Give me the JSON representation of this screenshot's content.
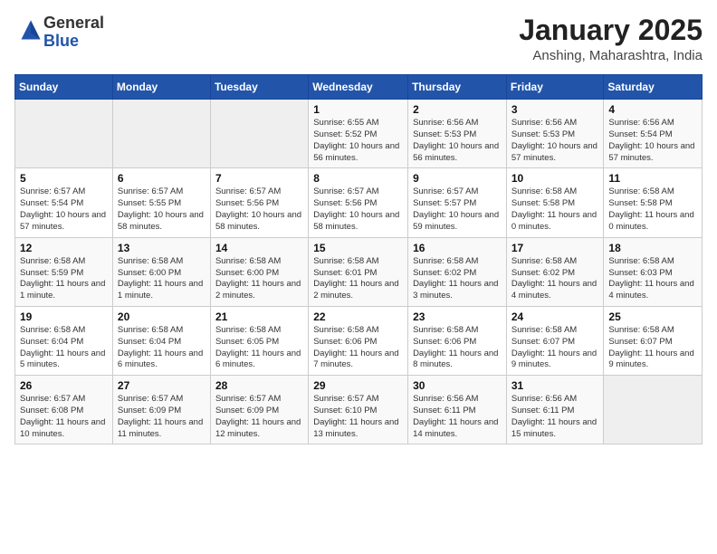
{
  "logo": {
    "general": "General",
    "blue": "Blue"
  },
  "header": {
    "title": "January 2025",
    "subtitle": "Anshing, Maharashtra, India"
  },
  "days_of_week": [
    "Sunday",
    "Monday",
    "Tuesday",
    "Wednesday",
    "Thursday",
    "Friday",
    "Saturday"
  ],
  "weeks": [
    [
      {
        "day": null
      },
      {
        "day": null
      },
      {
        "day": null
      },
      {
        "day": 1,
        "sunrise": "Sunrise: 6:55 AM",
        "sunset": "Sunset: 5:52 PM",
        "daylight": "Daylight: 10 hours and 56 minutes."
      },
      {
        "day": 2,
        "sunrise": "Sunrise: 6:56 AM",
        "sunset": "Sunset: 5:53 PM",
        "daylight": "Daylight: 10 hours and 56 minutes."
      },
      {
        "day": 3,
        "sunrise": "Sunrise: 6:56 AM",
        "sunset": "Sunset: 5:53 PM",
        "daylight": "Daylight: 10 hours and 57 minutes."
      },
      {
        "day": 4,
        "sunrise": "Sunrise: 6:56 AM",
        "sunset": "Sunset: 5:54 PM",
        "daylight": "Daylight: 10 hours and 57 minutes."
      }
    ],
    [
      {
        "day": 5,
        "sunrise": "Sunrise: 6:57 AM",
        "sunset": "Sunset: 5:54 PM",
        "daylight": "Daylight: 10 hours and 57 minutes."
      },
      {
        "day": 6,
        "sunrise": "Sunrise: 6:57 AM",
        "sunset": "Sunset: 5:55 PM",
        "daylight": "Daylight: 10 hours and 58 minutes."
      },
      {
        "day": 7,
        "sunrise": "Sunrise: 6:57 AM",
        "sunset": "Sunset: 5:56 PM",
        "daylight": "Daylight: 10 hours and 58 minutes."
      },
      {
        "day": 8,
        "sunrise": "Sunrise: 6:57 AM",
        "sunset": "Sunset: 5:56 PM",
        "daylight": "Daylight: 10 hours and 58 minutes."
      },
      {
        "day": 9,
        "sunrise": "Sunrise: 6:57 AM",
        "sunset": "Sunset: 5:57 PM",
        "daylight": "Daylight: 10 hours and 59 minutes."
      },
      {
        "day": 10,
        "sunrise": "Sunrise: 6:58 AM",
        "sunset": "Sunset: 5:58 PM",
        "daylight": "Daylight: 11 hours and 0 minutes."
      },
      {
        "day": 11,
        "sunrise": "Sunrise: 6:58 AM",
        "sunset": "Sunset: 5:58 PM",
        "daylight": "Daylight: 11 hours and 0 minutes."
      }
    ],
    [
      {
        "day": 12,
        "sunrise": "Sunrise: 6:58 AM",
        "sunset": "Sunset: 5:59 PM",
        "daylight": "Daylight: 11 hours and 1 minute."
      },
      {
        "day": 13,
        "sunrise": "Sunrise: 6:58 AM",
        "sunset": "Sunset: 6:00 PM",
        "daylight": "Daylight: 11 hours and 1 minute."
      },
      {
        "day": 14,
        "sunrise": "Sunrise: 6:58 AM",
        "sunset": "Sunset: 6:00 PM",
        "daylight": "Daylight: 11 hours and 2 minutes."
      },
      {
        "day": 15,
        "sunrise": "Sunrise: 6:58 AM",
        "sunset": "Sunset: 6:01 PM",
        "daylight": "Daylight: 11 hours and 2 minutes."
      },
      {
        "day": 16,
        "sunrise": "Sunrise: 6:58 AM",
        "sunset": "Sunset: 6:02 PM",
        "daylight": "Daylight: 11 hours and 3 minutes."
      },
      {
        "day": 17,
        "sunrise": "Sunrise: 6:58 AM",
        "sunset": "Sunset: 6:02 PM",
        "daylight": "Daylight: 11 hours and 4 minutes."
      },
      {
        "day": 18,
        "sunrise": "Sunrise: 6:58 AM",
        "sunset": "Sunset: 6:03 PM",
        "daylight": "Daylight: 11 hours and 4 minutes."
      }
    ],
    [
      {
        "day": 19,
        "sunrise": "Sunrise: 6:58 AM",
        "sunset": "Sunset: 6:04 PM",
        "daylight": "Daylight: 11 hours and 5 minutes."
      },
      {
        "day": 20,
        "sunrise": "Sunrise: 6:58 AM",
        "sunset": "Sunset: 6:04 PM",
        "daylight": "Daylight: 11 hours and 6 minutes."
      },
      {
        "day": 21,
        "sunrise": "Sunrise: 6:58 AM",
        "sunset": "Sunset: 6:05 PM",
        "daylight": "Daylight: 11 hours and 6 minutes."
      },
      {
        "day": 22,
        "sunrise": "Sunrise: 6:58 AM",
        "sunset": "Sunset: 6:06 PM",
        "daylight": "Daylight: 11 hours and 7 minutes."
      },
      {
        "day": 23,
        "sunrise": "Sunrise: 6:58 AM",
        "sunset": "Sunset: 6:06 PM",
        "daylight": "Daylight: 11 hours and 8 minutes."
      },
      {
        "day": 24,
        "sunrise": "Sunrise: 6:58 AM",
        "sunset": "Sunset: 6:07 PM",
        "daylight": "Daylight: 11 hours and 9 minutes."
      },
      {
        "day": 25,
        "sunrise": "Sunrise: 6:58 AM",
        "sunset": "Sunset: 6:07 PM",
        "daylight": "Daylight: 11 hours and 9 minutes."
      }
    ],
    [
      {
        "day": 26,
        "sunrise": "Sunrise: 6:57 AM",
        "sunset": "Sunset: 6:08 PM",
        "daylight": "Daylight: 11 hours and 10 minutes."
      },
      {
        "day": 27,
        "sunrise": "Sunrise: 6:57 AM",
        "sunset": "Sunset: 6:09 PM",
        "daylight": "Daylight: 11 hours and 11 minutes."
      },
      {
        "day": 28,
        "sunrise": "Sunrise: 6:57 AM",
        "sunset": "Sunset: 6:09 PM",
        "daylight": "Daylight: 11 hours and 12 minutes."
      },
      {
        "day": 29,
        "sunrise": "Sunrise: 6:57 AM",
        "sunset": "Sunset: 6:10 PM",
        "daylight": "Daylight: 11 hours and 13 minutes."
      },
      {
        "day": 30,
        "sunrise": "Sunrise: 6:56 AM",
        "sunset": "Sunset: 6:11 PM",
        "daylight": "Daylight: 11 hours and 14 minutes."
      },
      {
        "day": 31,
        "sunrise": "Sunrise: 6:56 AM",
        "sunset": "Sunset: 6:11 PM",
        "daylight": "Daylight: 11 hours and 15 minutes."
      },
      {
        "day": null
      }
    ]
  ]
}
